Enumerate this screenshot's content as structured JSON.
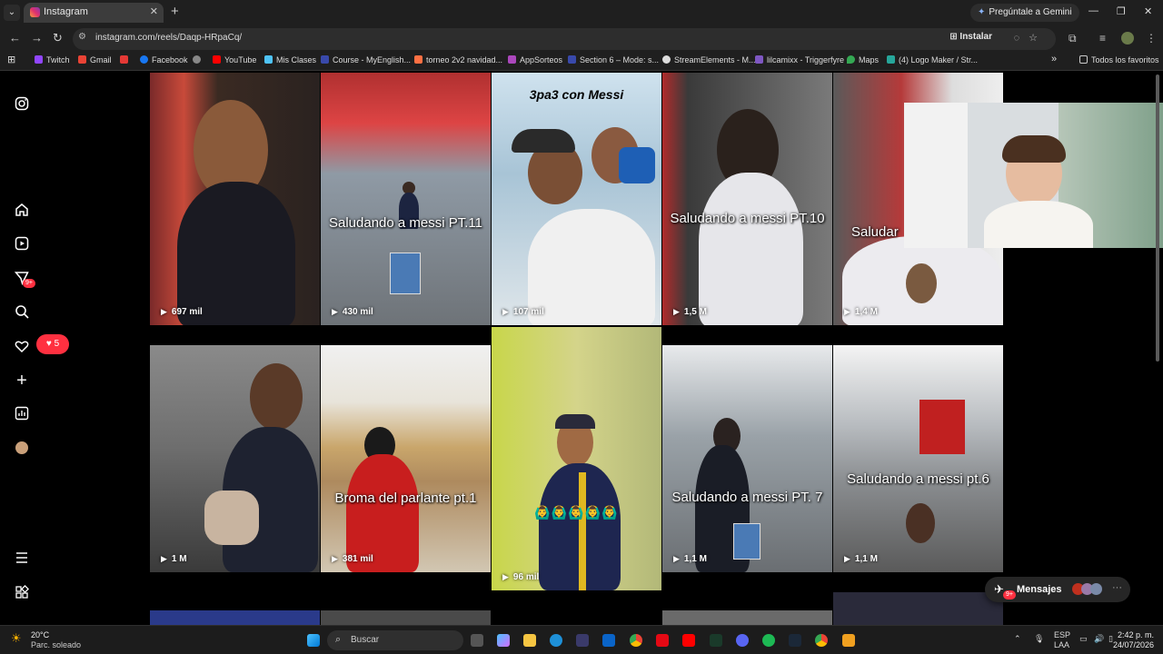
{
  "browser": {
    "tab_title": "Instagram",
    "gemini_label": "Pregúntale a Gemini",
    "url": "instagram.com/reels/Daqp-HRpaCq/",
    "install_label": "Instalar",
    "bookmarks": [
      "Twitch",
      "Gmail",
      "Facebook",
      "",
      "YouTube",
      "Mis Clases",
      "Course - MyEnglish...",
      "torneo 2v2 navidad...",
      "AppSorteos",
      "Section 6 – Mode: s...",
      "StreamElements - M...",
      "lilcamixx - Triggerfyre",
      "Maps",
      "(4) Logo Maker / Str..."
    ],
    "all_bookmarks": "Todos los favoritos"
  },
  "sidebar": {
    "messages_badge": "9+",
    "notifications_count": "5"
  },
  "reels": [
    {
      "views": "697 mil",
      "caption": ""
    },
    {
      "views": "430 mil",
      "caption": "Saludando a messi PT.11"
    },
    {
      "views": "107 mil",
      "caption": "",
      "top_caption": "3pa3 con Messi"
    },
    {
      "views": "1,5 M",
      "caption": "Saludando a messi PT.10"
    },
    {
      "views": "1,4 M",
      "caption": "Saludar"
    },
    {
      "views": "1 M",
      "caption": ""
    },
    {
      "views": "381 mil",
      "caption": "Broma del parlante pt.1"
    },
    {
      "views": "96 mil",
      "caption": "",
      "emoji_row": "🙆‍♂️🙆‍♂️🙆‍♂️🙆‍♂️🙆‍♂️"
    },
    {
      "views": "1,1 M",
      "caption": "Saludando a messi PT. 7"
    },
    {
      "views": "1,1 M",
      "caption": "Saludando a messi pt.6"
    }
  ],
  "messages": {
    "label": "Mensajes",
    "badge": "9+"
  },
  "taskbar": {
    "temperature": "20°C",
    "weather": "Parc. soleado",
    "search_placeholder": "Buscar",
    "lang_top": "ESP",
    "lang_bottom": "LAA",
    "time": "2:42 p. m.",
    "date": "24/07/2026"
  }
}
